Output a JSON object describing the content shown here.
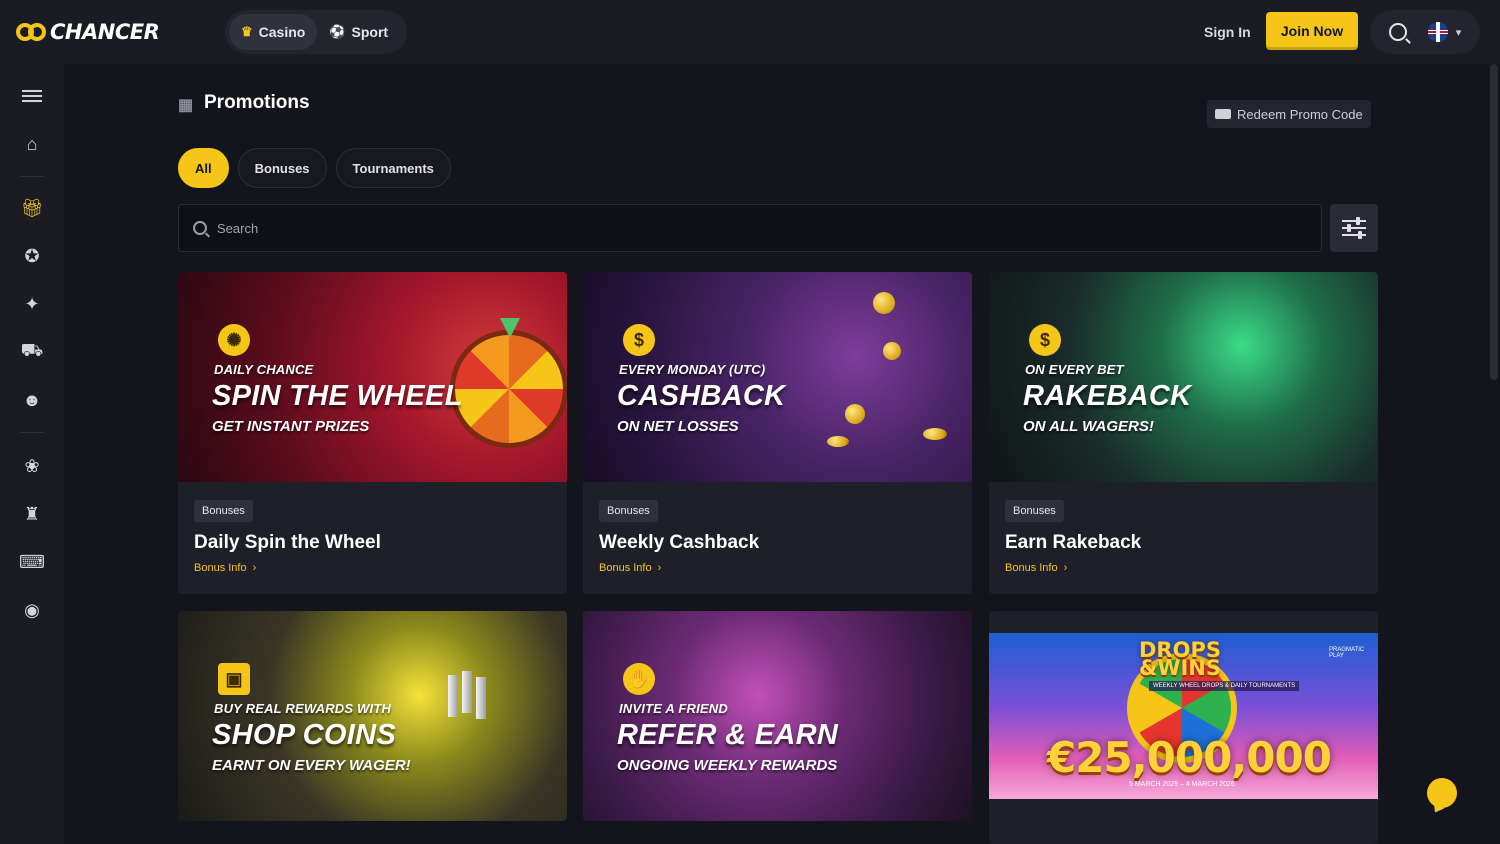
{
  "header": {
    "brand": "CHANCER",
    "modes": [
      {
        "label": "Casino",
        "icon": "casino-icon",
        "active": true
      },
      {
        "label": "Sport",
        "icon": "sport-icon",
        "active": false
      }
    ],
    "sign_in": "Sign In",
    "join_now": "Join Now",
    "language_icon": "uk-flag-icon"
  },
  "sidebar": {
    "items": [
      {
        "name": "menu",
        "icon": "hamburger-icon"
      },
      {
        "name": "home",
        "icon": "home-icon"
      },
      {
        "name": "promotions",
        "icon": "gift-icon",
        "active": true
      },
      {
        "name": "vip",
        "icon": "medal-icon"
      },
      {
        "name": "raffle",
        "icon": "ticket-icon"
      },
      {
        "name": "shop",
        "icon": "cart-icon"
      },
      {
        "name": "refer",
        "icon": "users-icon"
      },
      {
        "name": "slots",
        "icon": "cherries-icon"
      },
      {
        "name": "live",
        "icon": "card-icon"
      },
      {
        "name": "games",
        "icon": "gamepad-icon"
      },
      {
        "name": "table",
        "icon": "chip-icon"
      }
    ]
  },
  "page": {
    "title": "Promotions",
    "redeem_label": "Redeem Promo Code",
    "tabs": [
      {
        "label": "All",
        "active": true
      },
      {
        "label": "Bonuses",
        "active": false
      },
      {
        "label": "Tournaments",
        "active": false
      }
    ],
    "search_placeholder": "Search"
  },
  "cards": [
    {
      "badge": "Bonuses",
      "title": "Daily Spin the Wheel",
      "link": "Bonus Info",
      "banner": {
        "pre": "DAILY CHANCE",
        "big": "SPIN THE WHEEL",
        "post": "GET INSTANT PRIZES"
      }
    },
    {
      "badge": "Bonuses",
      "title": "Weekly Cashback",
      "link": "Bonus Info",
      "banner": {
        "pre": "EVERY MONDAY (UTC)",
        "big": "CASHBACK",
        "post": "ON NET LOSSES"
      }
    },
    {
      "badge": "Bonuses",
      "title": "Earn Rakeback",
      "link": "Bonus Info",
      "banner": {
        "pre": "ON EVERY BET",
        "big": "RAKEBACK",
        "post": "ON ALL WAGERS!"
      }
    },
    {
      "banner": {
        "pre": "BUY REAL REWARDS WITH",
        "big": "SHOP COINS",
        "post": "EARNT ON EVERY WAGER!"
      }
    },
    {
      "banner": {
        "pre": "INVITE A FRIEND",
        "big": "REFER & EARN",
        "post": "ONGOING WEEKLY REWARDS"
      }
    },
    {
      "banner": {
        "title": "DROPS\n&WINS",
        "sub": "WEEKLY WHEEL DROPS & DAILY TOURNAMENTS",
        "amount": "€25,000,000",
        "date": "5 MARCH 2025 – 4 MARCH 2026",
        "provider": "PRAGMATIC PLAY"
      }
    }
  ],
  "colors": {
    "accent": "#f5c518",
    "background": "#14151c",
    "card": "#1e1f28"
  }
}
